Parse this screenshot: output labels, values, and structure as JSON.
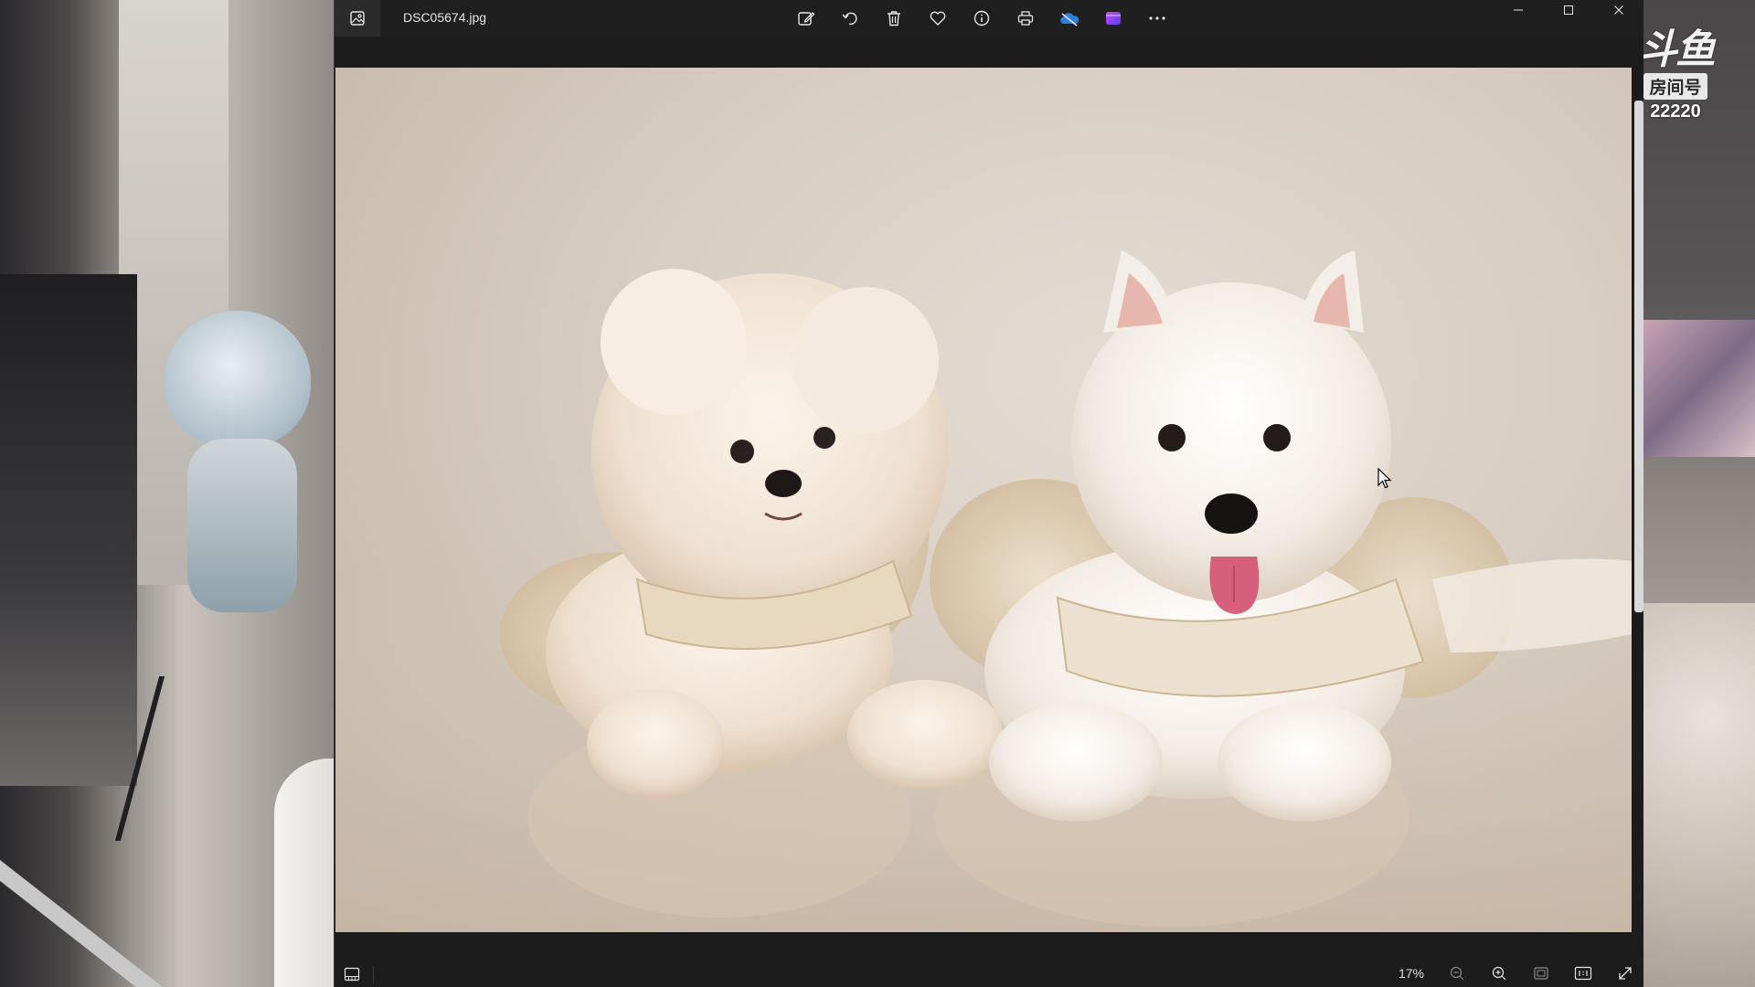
{
  "window": {
    "filename": "DSC05674.jpg",
    "zoom": "17%"
  },
  "toolbar": {
    "items": [
      {
        "name": "edit-image",
        "icon": "edit-icon"
      },
      {
        "name": "rotate",
        "icon": "rotate-icon"
      },
      {
        "name": "delete",
        "icon": "trash-icon"
      },
      {
        "name": "favorite",
        "icon": "heart-icon"
      },
      {
        "name": "file-info",
        "icon": "info-icon"
      },
      {
        "name": "print",
        "icon": "print-icon"
      },
      {
        "name": "onedrive",
        "icon": "cloud-icon"
      },
      {
        "name": "clipchamp",
        "icon": "clipchamp-icon"
      },
      {
        "name": "more",
        "icon": "more-icon"
      }
    ]
  },
  "overlay": {
    "logo_text": "斗鱼",
    "room_label": "房间号",
    "room_number": "22220"
  },
  "colors": {
    "titlebar": "#1f1f1f",
    "background": "#1c1c1c",
    "icon": "#e6e6e6",
    "onedrive_blue": "#2f7fe0",
    "clipchamp_purple": "#8a3ff0"
  }
}
